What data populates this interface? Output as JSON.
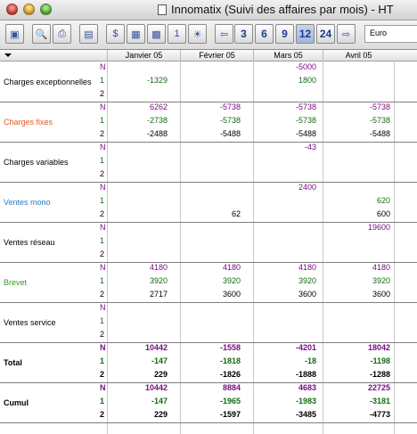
{
  "window": {
    "title": "Innomatix (Suivi des affaires par mois) - HT"
  },
  "toolbar": {
    "buttons": [
      "1",
      "2",
      "3",
      "4",
      "5",
      "6",
      "7",
      "8",
      "9"
    ],
    "page_buttons": [
      "3",
      "6",
      "9",
      "12",
      "24"
    ],
    "selected_page": "12",
    "currency": "Euro"
  },
  "columns": [
    "Janvier 05",
    "Février 05",
    "Mars 05",
    "Avril 05"
  ],
  "colors": {
    "purple": "#7b0d84",
    "green": "#136b13",
    "charges_fixes": "#e05a1a",
    "ventes_mono": "#2a7bbd",
    "brevet": "#3a9a1e"
  },
  "rows": [
    {
      "label": "Charges exceptionnelles",
      "labelColor": "#000000",
      "subs": [
        "N",
        "1",
        "2"
      ],
      "values": [
        [
          "",
          "",
          "-5000",
          ""
        ],
        [
          "-1329",
          "",
          "1800",
          ""
        ],
        [
          "",
          "",
          "",
          ""
        ]
      ]
    },
    {
      "label": "Charges fixes",
      "labelColor": "#e05a1a",
      "subs": [
        "N",
        "1",
        "2"
      ],
      "values": [
        [
          "6262",
          "-5738",
          "-5738",
          "-5738"
        ],
        [
          "-2738",
          "-5738",
          "-5738",
          "-5738"
        ],
        [
          "-2488",
          "-5488",
          "-5488",
          "-5488"
        ]
      ]
    },
    {
      "label": "Charges variables",
      "labelColor": "#000000",
      "subs": [
        "N",
        "1",
        "2"
      ],
      "values": [
        [
          "",
          "",
          "-43",
          ""
        ],
        [
          "",
          "",
          "",
          ""
        ],
        [
          "",
          "",
          "",
          ""
        ]
      ]
    },
    {
      "label": "Ventes mono",
      "labelColor": "#2a7bbd",
      "subs": [
        "N",
        "1",
        "2"
      ],
      "values": [
        [
          "",
          "",
          "2400",
          ""
        ],
        [
          "",
          "",
          "",
          "620"
        ],
        [
          "",
          "62",
          "",
          "600"
        ]
      ]
    },
    {
      "label": "Ventes réseau",
      "labelColor": "#000000",
      "subs": [
        "N",
        "1",
        "2"
      ],
      "values": [
        [
          "",
          "",
          "",
          "19600"
        ],
        [
          "",
          "",
          "",
          ""
        ],
        [
          "",
          "",
          "",
          ""
        ]
      ]
    },
    {
      "label": "Brevet",
      "labelColor": "#3a9a1e",
      "subs": [
        "N",
        "1",
        "2"
      ],
      "values": [
        [
          "4180",
          "4180",
          "4180",
          "4180"
        ],
        [
          "3920",
          "3920",
          "3920",
          "3920"
        ],
        [
          "2717",
          "3600",
          "3600",
          "3600"
        ]
      ]
    },
    {
      "label": "Ventes service",
      "labelColor": "#000000",
      "subs": [
        "N",
        "1",
        "2"
      ],
      "values": [
        [
          "",
          "",
          "",
          ""
        ],
        [
          "",
          "",
          "",
          ""
        ],
        [
          "",
          "",
          "",
          ""
        ]
      ]
    },
    {
      "label": "Total",
      "labelColor": "#000000",
      "bold": true,
      "subs": [
        "N",
        "1",
        "2"
      ],
      "values": [
        [
          "10442",
          "-1558",
          "-4201",
          "18042"
        ],
        [
          "-147",
          "-1818",
          "-18",
          "-1198"
        ],
        [
          "229",
          "-1826",
          "-1888",
          "-1288"
        ]
      ]
    },
    {
      "label": "Cumul",
      "labelColor": "#000000",
      "bold": true,
      "subs": [
        "N",
        "1",
        "2"
      ],
      "values": [
        [
          "10442",
          "8884",
          "4683",
          "22725"
        ],
        [
          "-147",
          "-1965",
          "-1983",
          "-3181"
        ],
        [
          "229",
          "-1597",
          "-3485",
          "-4773"
        ]
      ]
    }
  ]
}
